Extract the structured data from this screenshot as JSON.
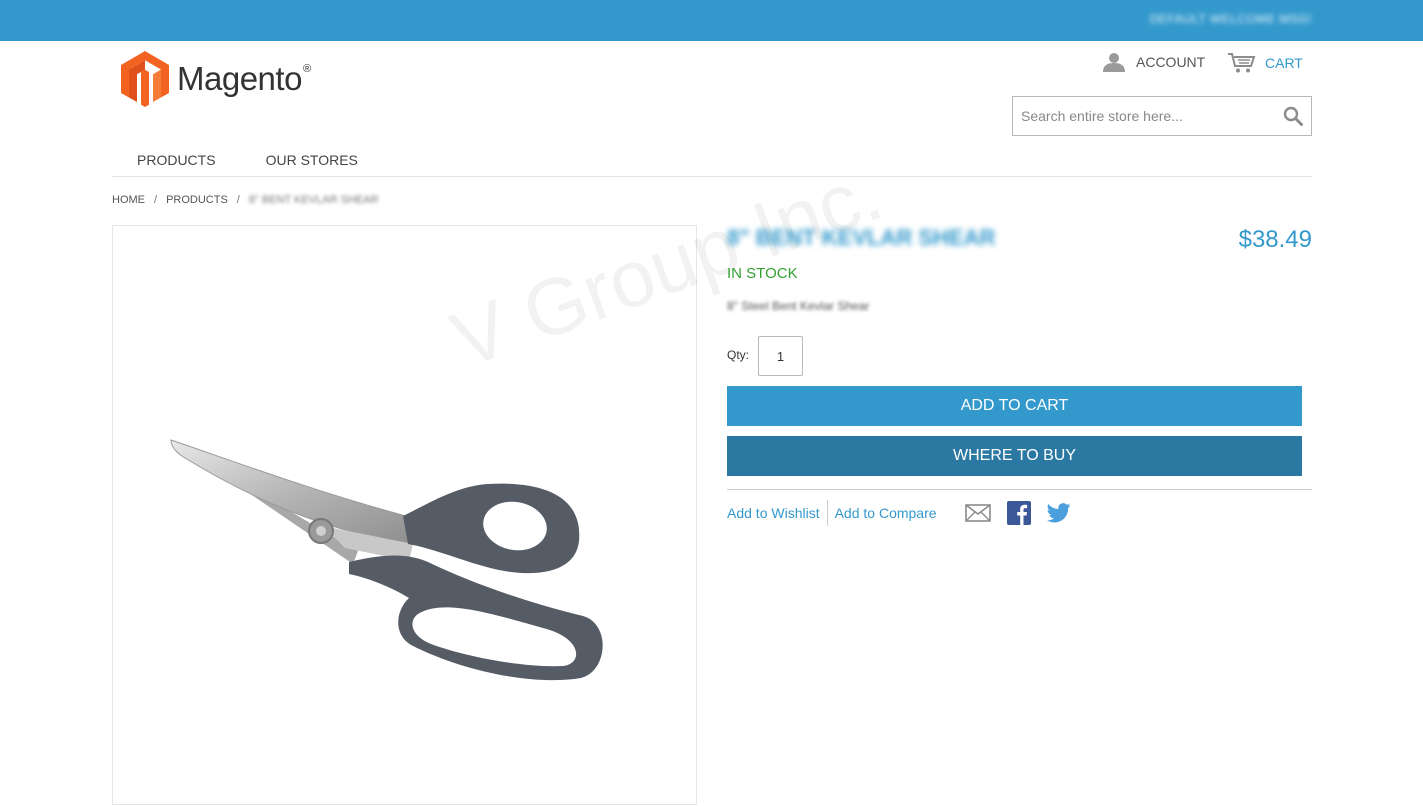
{
  "topbar": {
    "welcome": "DEFAULT WELCOME MSG!"
  },
  "logo": {
    "text": "Magento",
    "reg": "®"
  },
  "header": {
    "account_label": "ACCOUNT",
    "cart_label": "CART"
  },
  "search": {
    "placeholder": "Search entire store here..."
  },
  "nav": {
    "items": [
      {
        "label": "PRODUCTS"
      },
      {
        "label": "OUR STORES"
      }
    ]
  },
  "breadcrumb": {
    "home": "HOME",
    "products": "PRODUCTS",
    "current": "8\" BENT KEVLAR SHEAR",
    "separator": "/"
  },
  "product": {
    "name": "8\" BENT KEVLAR SHEAR",
    "price": "$38.49",
    "stock": "IN STOCK",
    "short_description": "8\" Steel Bent Kevlar Shear",
    "qty_label": "Qty:",
    "qty_value": "1",
    "add_to_cart": "ADD TO CART",
    "where_to_buy": "WHERE TO BUY",
    "add_to_wishlist": "Add to Wishlist",
    "add_to_compare": "Add to Compare"
  },
  "watermark": "V Group Inc.",
  "colors": {
    "accent": "#3399cc",
    "accent_dark": "#2b78a3",
    "stock_green": "#33a033",
    "logo_orange": "#f26322"
  }
}
